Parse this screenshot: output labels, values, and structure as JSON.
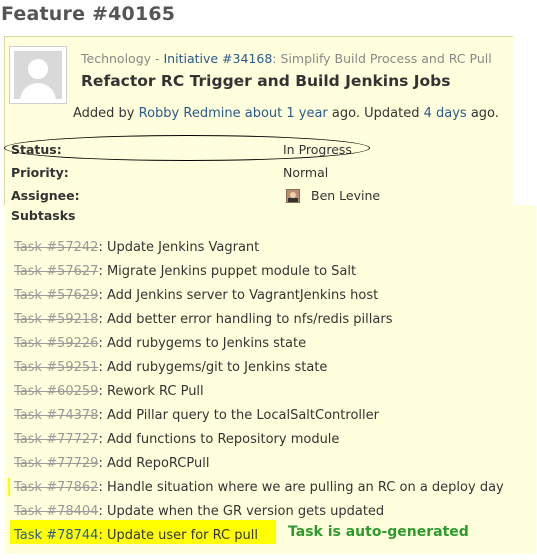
{
  "feature": {
    "title": "Feature #40165"
  },
  "issue": {
    "tracker": "Technology",
    "parent_link": "Initiative #34168",
    "parent_title": ": Simplify Build Process and RC Pull",
    "subject": "Refactor RC Trigger and Build Jenkins Jobs",
    "meta": {
      "added_by_prefix": "Added by",
      "author": "Robby Redmine",
      "created_ago": "about 1 year",
      "mid_text": "ago. Updated",
      "updated_ago": "4 days",
      "suffix": "ago."
    },
    "attributes": {
      "status_label": "Status:",
      "status_value": "In Progress",
      "priority_label": "Priority:",
      "priority_value": "Normal",
      "assignee_label": "Assignee:",
      "assignee_value": "Ben Levine"
    }
  },
  "subtasks": {
    "label": "Subtasks",
    "items": [
      {
        "id": "Task #57242",
        "title": ": Update Jenkins Vagrant",
        "closed": true
      },
      {
        "id": "Task #57627",
        "title": ": Migrate Jenkins puppet module to Salt",
        "closed": true
      },
      {
        "id": "Task #57629",
        "title": ": Add Jenkins server to VagrantJenkins host",
        "closed": true
      },
      {
        "id": "Task #59218",
        "title": ": Add better error handling to nfs/redis pillars",
        "closed": true
      },
      {
        "id": "Task #59226",
        "title": ": Add rubygems to Jenkins state",
        "closed": true
      },
      {
        "id": "Task #59251",
        "title": ": Add rubygems/git to Jenkins state",
        "closed": true
      },
      {
        "id": "Task #60259",
        "title": ": Rework RC Pull",
        "closed": true
      },
      {
        "id": "Task #74378",
        "title": ": Add Pillar query to the LocalSaltController",
        "closed": true
      },
      {
        "id": "Task #77727",
        "title": ": Add functions to Repository module",
        "closed": true
      },
      {
        "id": "Task #77729",
        "title": ": Add RepoRCPull",
        "closed": true
      },
      {
        "id": "Task #77862",
        "title": ": Handle situation where we are pulling an RC on a deploy day",
        "closed": true
      },
      {
        "id": "Task #78404",
        "title": ": Update when the GR version gets updated",
        "closed": true
      },
      {
        "id": "Task #78744",
        "title": ": Update user for RC pull",
        "closed": false
      }
    ]
  },
  "annotation": {
    "note": "Task is auto-generated",
    "note_color": "#2e9a2e",
    "highlight_color": "#ffff00"
  }
}
